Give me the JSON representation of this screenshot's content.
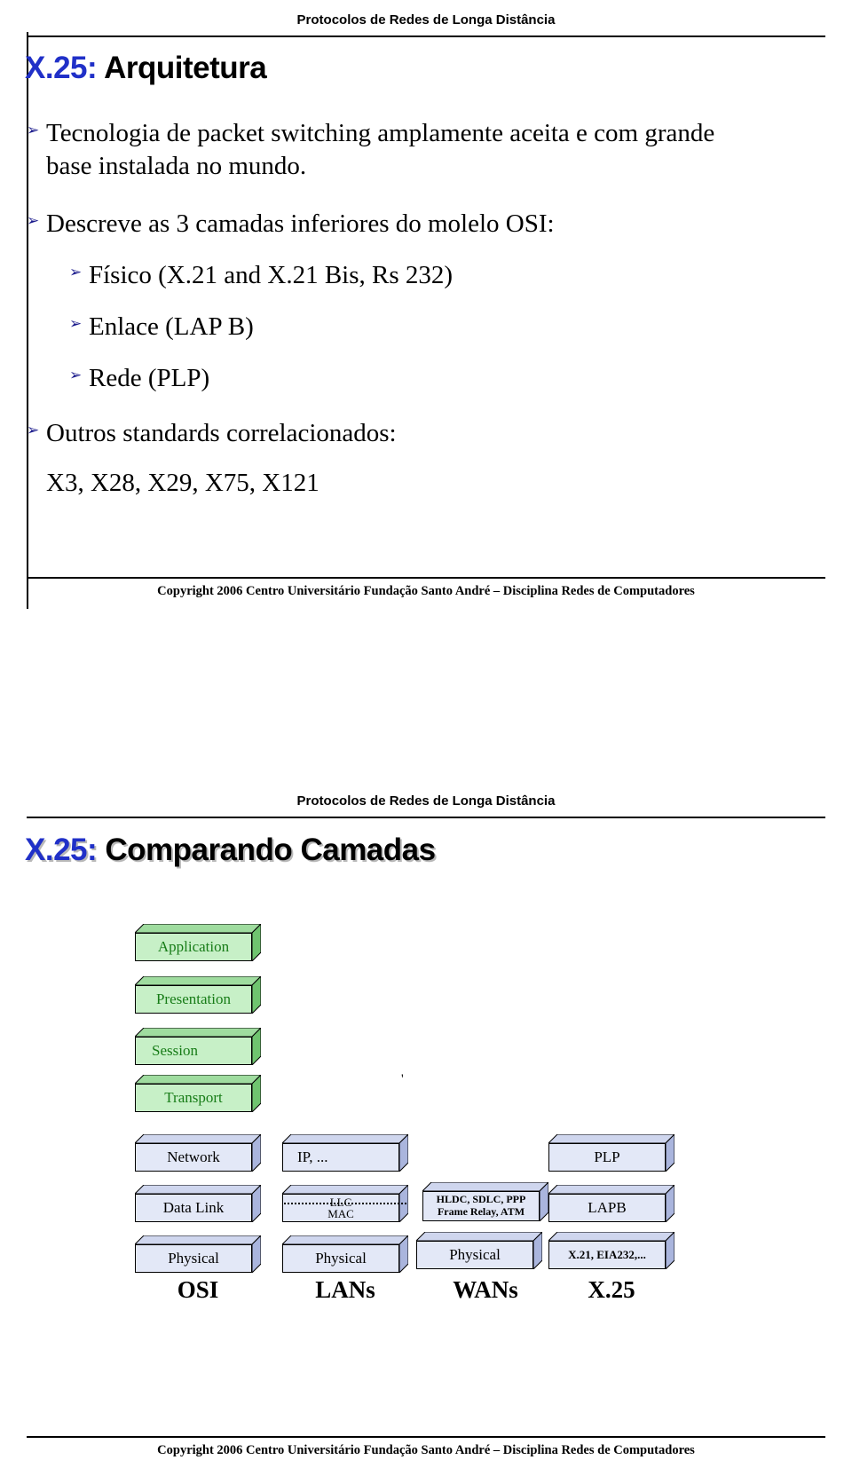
{
  "document": {
    "header_title": "Protocolos de Redes de Longa Distância",
    "footer_text": "Copyright 2006 Centro Universitário Fundação Santo André – Disciplina Redes de Computadores"
  },
  "slide1": {
    "title_prefix": "X.25:",
    "title_rest": " Arquitetura",
    "bullets": [
      {
        "glyph": "➢",
        "text": "Tecnologia de packet switching amplamente aceita e com grande base instalada no mundo."
      },
      {
        "glyph": "➢",
        "text": "Descreve as 3 camadas inferiores do molelo OSI:"
      },
      {
        "glyph": "➢",
        "text": "Físico (X.21 and X.21 Bis, Rs 232)"
      },
      {
        "glyph": "➢",
        "text": "Enlace  (LAP B)"
      },
      {
        "glyph": "➢",
        "text": "Rede  (PLP)"
      },
      {
        "glyph": "➢",
        "text": "Outros standards correlacionados:"
      }
    ],
    "standards_line": "X3, X28, X29, X75, X121"
  },
  "slide2": {
    "title_prefix": "X.25:",
    "title_rest": " Comparando Camadas",
    "columns": [
      {
        "name": "OSI",
        "label": "OSI"
      },
      {
        "name": "LANs",
        "label": "LANs"
      },
      {
        "name": "WANs",
        "label": "WANs"
      },
      {
        "name": "X25",
        "label": "X.25"
      }
    ],
    "osi_layers": [
      "Application",
      "Presentation",
      "Session",
      "Transport",
      "Network",
      "Data Link",
      "Physical"
    ],
    "lan_boxes": {
      "network": "IP, ...",
      "llc": "LLC",
      "mac": "MAC",
      "physical": "Physical"
    },
    "wan_boxes": {
      "datalink_line1": "HLDC, SDLC, PPP",
      "datalink_line2": "Frame Relay, ATM",
      "physical": "Physical"
    },
    "x25_boxes": {
      "network": "PLP",
      "datalink": "LAPB",
      "physical": "X.21, EIA232,..."
    }
  }
}
